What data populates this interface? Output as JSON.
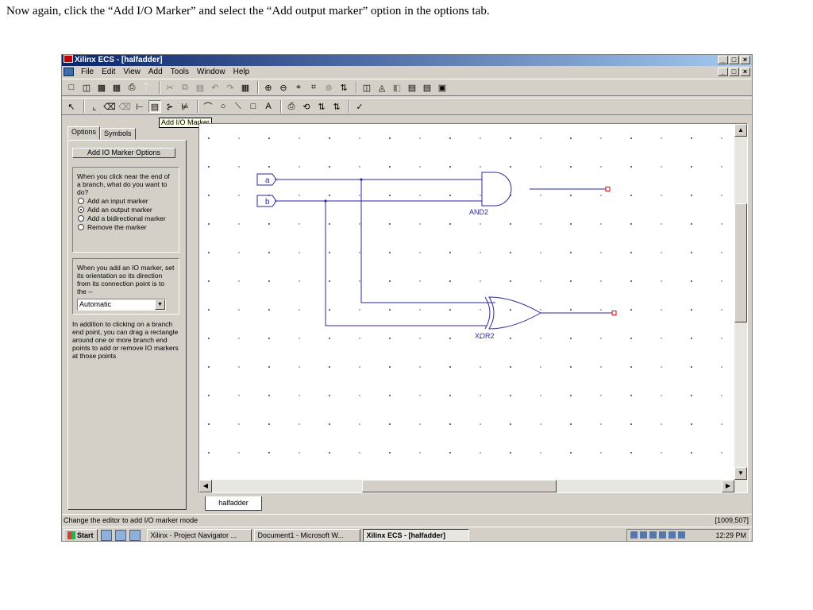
{
  "instruction": "Now again, click the “Add I/O Marker” and select the “Add output marker” option in the options tab.",
  "window": {
    "title": "Xilinx ECS - [halfadder]",
    "controls": [
      "_",
      "□",
      "×"
    ]
  },
  "menu": [
    "File",
    "Edit",
    "View",
    "Add",
    "Tools",
    "Window",
    "Help"
  ],
  "tooltip": "Add I/O Marker",
  "panel": {
    "tabs": [
      "Options",
      "Symbols"
    ],
    "header": "Add IO Marker Options",
    "question": "When you click near the end of a branch, what do you want to do?",
    "radios": [
      {
        "label": "Add an input marker",
        "selected": false
      },
      {
        "label": "Add an output marker",
        "selected": true
      },
      {
        "label": "Add a bidirectional marker",
        "selected": false
      },
      {
        "label": "Remove the marker",
        "selected": false
      }
    ],
    "orientation_text": "When you add an IO marker, set its orientation so its direction from its connection point is to the --",
    "orientation_value": "Automatic",
    "help": "In addition to clicking on a branch end point, you can drag a rectangle around one or more branch end points to add or remove  IO markers at those points"
  },
  "schematic": {
    "inputs": [
      "a",
      "b"
    ],
    "gates": [
      "AND2",
      "XOR2"
    ]
  },
  "sheet_tab": "halfadder",
  "status": {
    "text": "Change the editor to add I/O marker mode",
    "coords": "[1009,507]"
  },
  "taskbar": {
    "start": "Start",
    "tasks": [
      "Xilinx - Project Navigator ...",
      "Document1 - Microsoft W...",
      "Xilinx ECS - [halfadder]"
    ],
    "clock": "12:29 PM"
  }
}
